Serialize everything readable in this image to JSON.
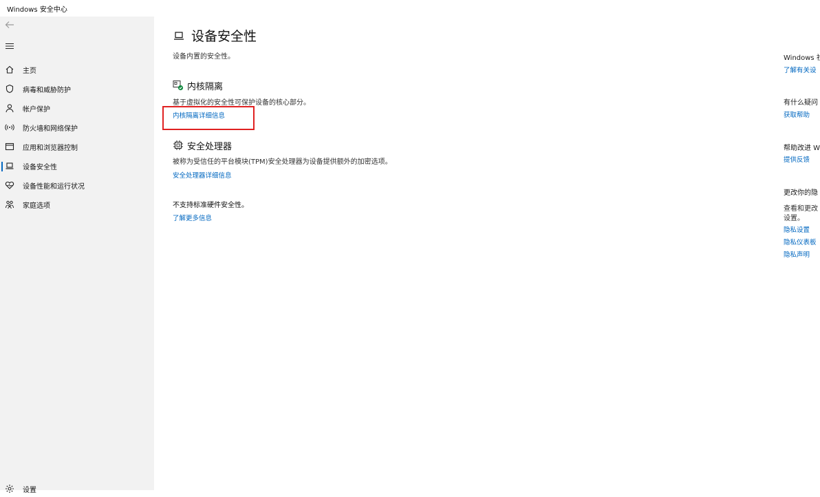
{
  "window": {
    "title": "Windows 安全中心"
  },
  "sidebar": {
    "items": [
      {
        "label": "主页",
        "icon": "home-icon"
      },
      {
        "label": "病毒和威胁防护",
        "icon": "shield-icon"
      },
      {
        "label": "帐户保护",
        "icon": "person-icon"
      },
      {
        "label": "防火墙和网络保护",
        "icon": "wifi-antenna-icon"
      },
      {
        "label": "应用和浏览器控制",
        "icon": "app-window-icon"
      },
      {
        "label": "设备安全性",
        "icon": "laptop-icon",
        "active": true
      },
      {
        "label": "设备性能和运行状况",
        "icon": "heart-icon"
      },
      {
        "label": "家庭选项",
        "icon": "family-icon"
      }
    ],
    "settings_label": "设置"
  },
  "main": {
    "title": "设备安全性",
    "subtitle": "设备内置的安全性。",
    "core_isolation": {
      "title": "内核隔离",
      "description": "基于虚拟化的安全性可保护设备的核心部分。",
      "link": "内核隔离详细信息"
    },
    "security_processor": {
      "title": "安全处理器",
      "description": "被称为受信任的平台模块(TPM)安全处理器为设备提供额外的加密选项。",
      "link": "安全处理器详细信息"
    },
    "hardware_note": "不支持标准硬件安全性。",
    "learn_more": "了解更多信息"
  },
  "right_panel": {
    "community_title": "Windows 社",
    "community_link": "了解有关设",
    "question_title": "有什么疑问",
    "help_link": "获取帮助",
    "improve_title": "帮助改进 W",
    "feedback_link": "提供反馈",
    "privacy_title": "更改你的隐",
    "privacy_desc_1": "查看和更改",
    "privacy_desc_2": "设置。",
    "privacy_settings_link": "隐私设置",
    "privacy_dashboard_link": "隐私仪表板",
    "privacy_statement_link": "隐私声明"
  },
  "colors": {
    "accent": "#0067c0",
    "highlight_box": "#e02020",
    "sidebar_bg": "#f2f2f2",
    "status_ok": "#10893e"
  }
}
